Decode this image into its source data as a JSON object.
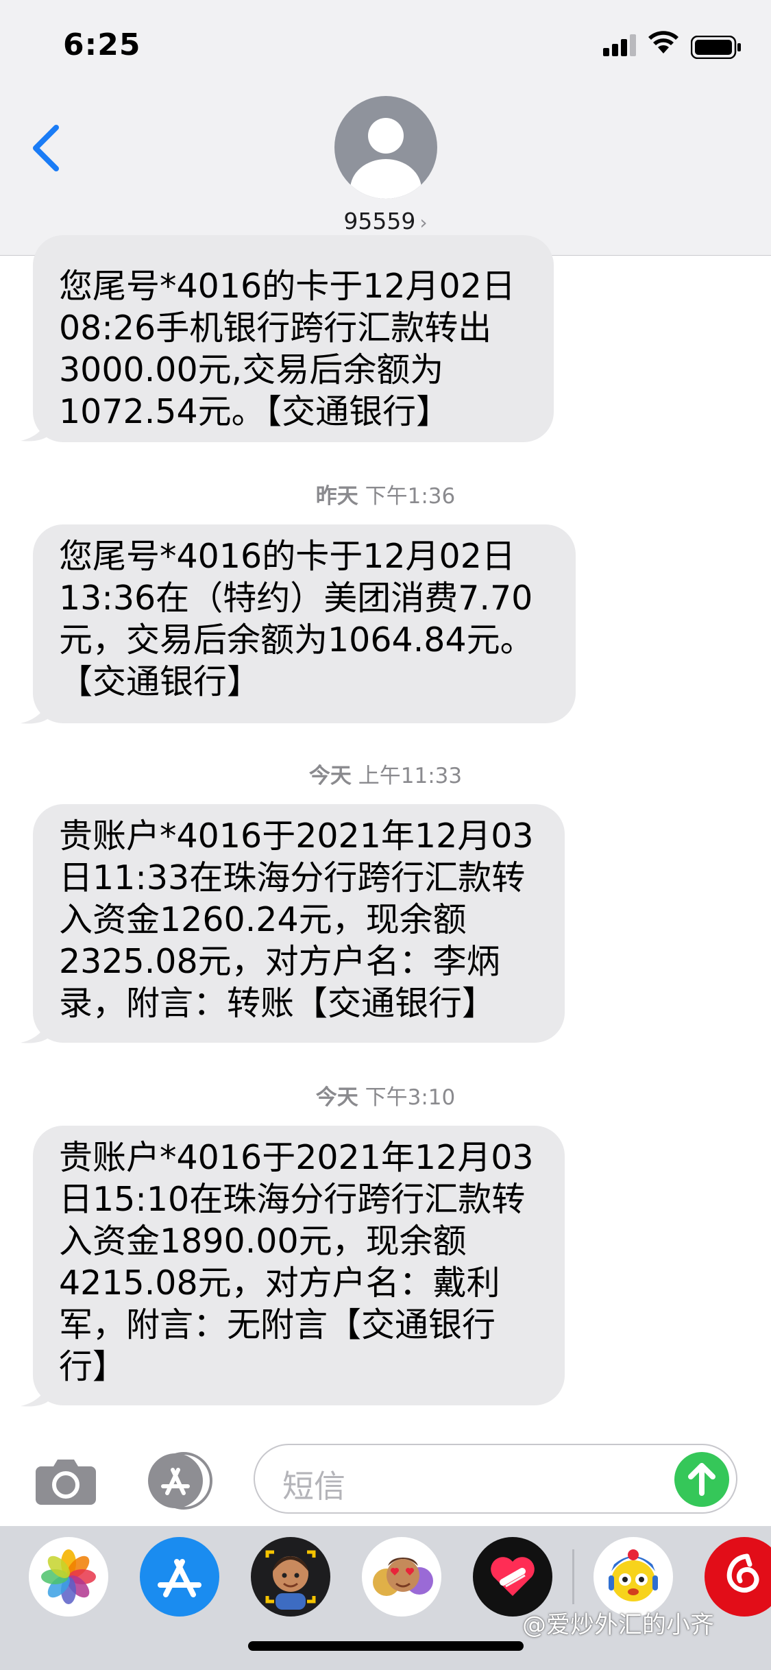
{
  "status_bar": {
    "time": "6:25"
  },
  "header": {
    "contact": "95559",
    "contact_chevron": "›"
  },
  "messages": [
    {
      "lines": [
        "您尾号*4016的卡于12月02日",
        "08:26手机银行跨行汇款转出",
        "3000.00元,交易后余额为",
        "1072.54元。【交通银行】"
      ]
    },
    {
      "stamp_day": "昨天",
      "stamp_time": "下午1:36",
      "lines": [
        "您尾号*4016的卡于12月02日",
        "13:36在（特约）美团消费7.70",
        "元，交易后余额为1064.84元。",
        "【交通银行】"
      ]
    },
    {
      "stamp_day": "今天",
      "stamp_time": "上午11:33",
      "lines": [
        "贵账户*4016于2021年12月03",
        "日11:33在珠海分行跨行汇款转",
        "入资金1260.24元，现余额",
        "2325.08元，对方户名：李炳",
        "录，附言：转账【交通银行】"
      ]
    },
    {
      "stamp_day": "今天",
      "stamp_time": "下午3:10",
      "lines": [
        "贵账户*4016于2021年12月03",
        "日15:10在珠海分行跨行汇款转",
        "入资金1890.00元，现余额",
        "4215.08元，对方户名：戴利",
        "军，附言：无附言【交通银行",
        "行】"
      ]
    }
  ],
  "input": {
    "placeholder": "短信"
  },
  "watermark": "@爱炒外汇的小齐",
  "colors": {
    "accent": "#1a7cf6",
    "send": "#35c759",
    "bubble": "#e9e9eb"
  },
  "icons": [
    "back-chevron-icon",
    "avatar-icon",
    "camera-icon",
    "app-store-icon",
    "send-arrow-icon",
    "photos-icon",
    "memoji-icon",
    "heart-icon",
    "sticker-icon",
    "netease-music-icon"
  ]
}
